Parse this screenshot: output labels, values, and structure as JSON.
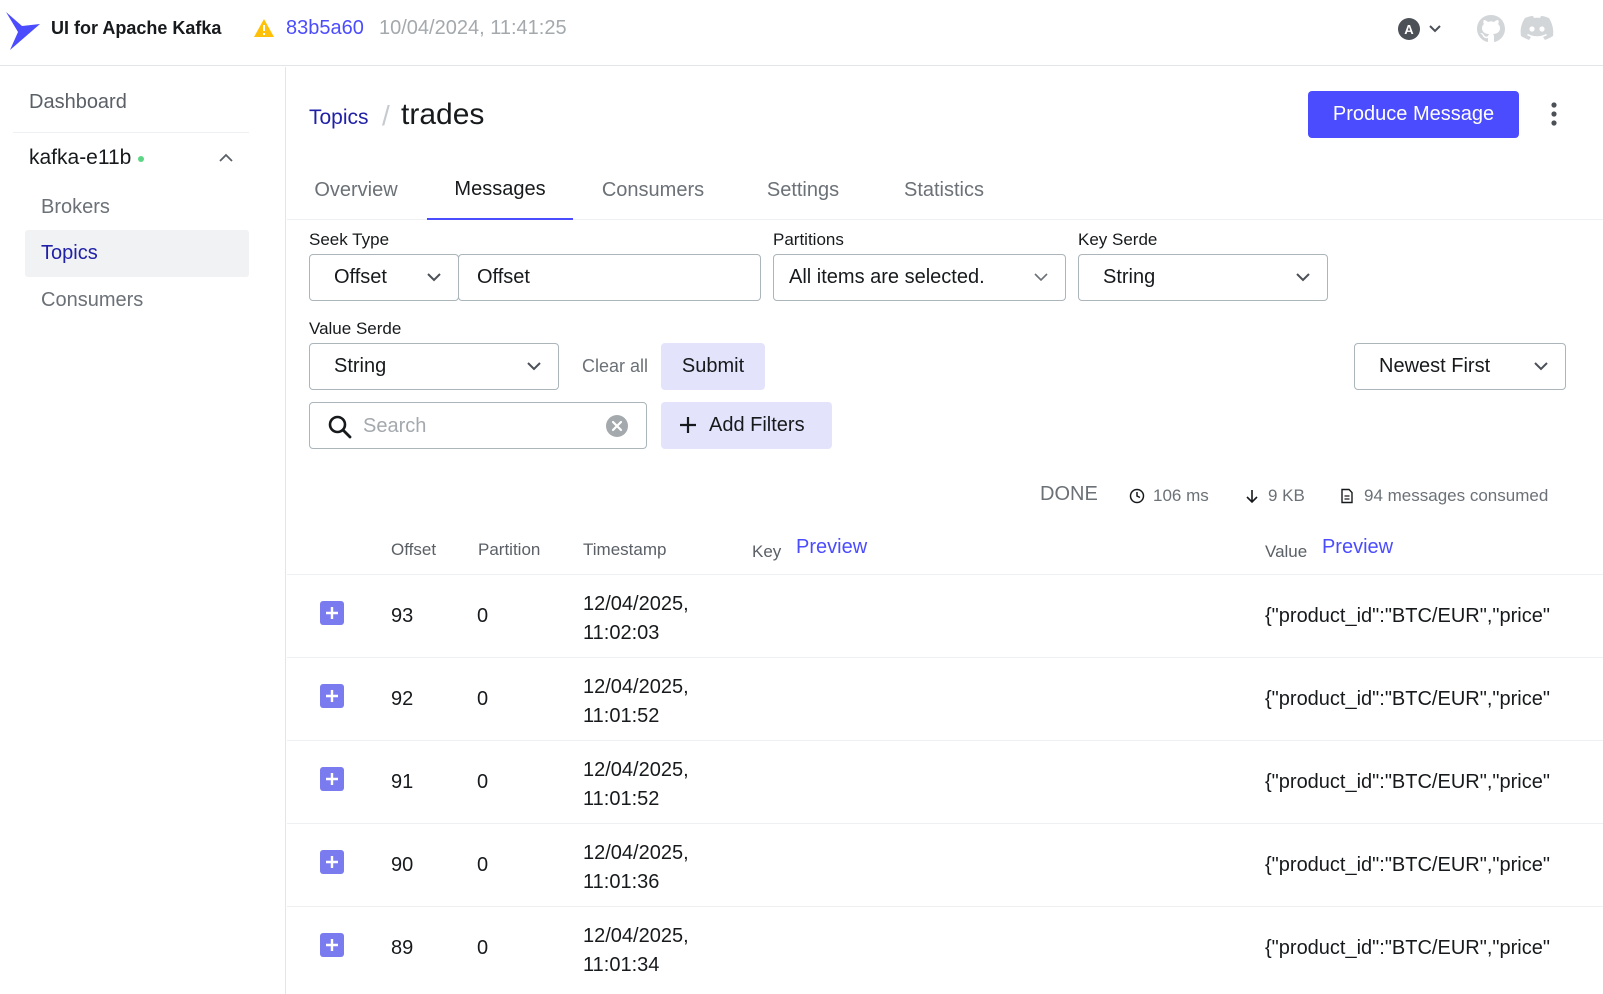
{
  "header": {
    "app_title": "UI for Apache Kafka",
    "commit": "83b5a60",
    "build_date": "10/04/2024, 11:41:25",
    "user_initial": "A"
  },
  "sidebar": {
    "dashboard": "Dashboard",
    "cluster_name": "kafka-e11b",
    "items": [
      {
        "label": "Brokers",
        "active": false
      },
      {
        "label": "Topics",
        "active": true
      },
      {
        "label": "Consumers",
        "active": false
      }
    ]
  },
  "breadcrumb": {
    "parent": "Topics",
    "separator": "/",
    "current": "trades"
  },
  "actions": {
    "produce_label": "Produce Message"
  },
  "tabs": [
    {
      "label": "Overview",
      "active": false
    },
    {
      "label": "Messages",
      "active": true
    },
    {
      "label": "Consumers",
      "active": false
    },
    {
      "label": "Settings",
      "active": false
    },
    {
      "label": "Statistics",
      "active": false
    }
  ],
  "filters": {
    "seek_type_label": "Seek Type",
    "seek_type_value": "Offset",
    "offset_value": "Offset",
    "partitions_label": "Partitions",
    "partitions_value": "All items are selected.",
    "key_serde_label": "Key Serde",
    "key_serde_value": "String",
    "value_serde_label": "Value Serde",
    "value_serde_value": "String",
    "clear_all": "Clear all",
    "submit": "Submit",
    "sort_value": "Newest First",
    "search_placeholder": "Search",
    "add_filters": "Add Filters"
  },
  "stats": {
    "status": "DONE",
    "elapsed": "106 ms",
    "bytes": "9 KB",
    "consumed": "94 messages consumed"
  },
  "table": {
    "headers": {
      "offset": "Offset",
      "partition": "Partition",
      "timestamp": "Timestamp",
      "key": "Key",
      "key_preview": "Preview",
      "value": "Value",
      "value_preview": "Preview"
    },
    "rows": [
      {
        "offset": "93",
        "partition": "0",
        "date": "12/04/2025,",
        "time": "11:02:03",
        "value": "{\"product_id\":\"BTC/EUR\",\"price\""
      },
      {
        "offset": "92",
        "partition": "0",
        "date": "12/04/2025,",
        "time": "11:01:52",
        "value": "{\"product_id\":\"BTC/EUR\",\"price\""
      },
      {
        "offset": "91",
        "partition": "0",
        "date": "12/04/2025,",
        "time": "11:01:52",
        "value": "{\"product_id\":\"BTC/EUR\",\"price\""
      },
      {
        "offset": "90",
        "partition": "0",
        "date": "12/04/2025,",
        "time": "11:01:36",
        "value": "{\"product_id\":\"BTC/EUR\",\"price\""
      },
      {
        "offset": "89",
        "partition": "0",
        "date": "12/04/2025,",
        "time": "11:01:34",
        "value": "{\"product_id\":\"BTC/EUR\",\"price\""
      }
    ]
  },
  "colors": {
    "accent": "#4c4cff",
    "link": "#2121a8",
    "status_online": "#5cd685",
    "warning": "#ffc107"
  }
}
